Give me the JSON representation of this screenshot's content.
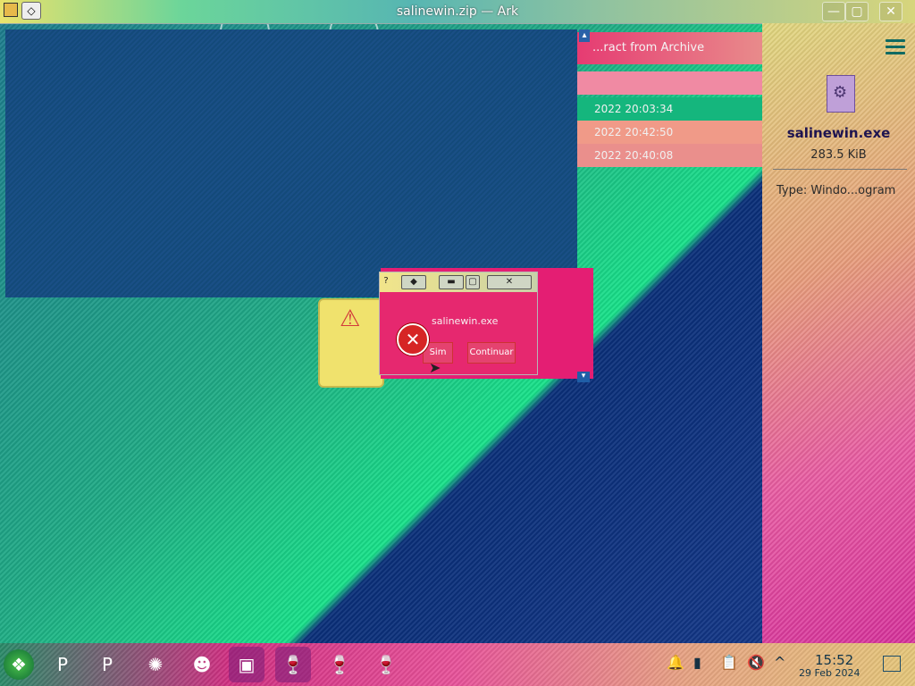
{
  "window": {
    "title": "salinewin.zip — Ark",
    "wm_menu_glyph": "◇",
    "minimize_glyph": "—",
    "maximize_glyph": "▢",
    "close_glyph": "✕"
  },
  "archive": {
    "header_label": "...ract from Archive",
    "rows": [
      {
        "modified": "2022 20:03:34"
      },
      {
        "modified": "2022 20:42:50"
      },
      {
        "modified": "2022 20:40:08"
      }
    ]
  },
  "details_panel": {
    "menu_icon": "hamburger-icon",
    "file_icon": "exe-file-icon",
    "file_name": "salinewin.exe",
    "file_size": "283.5 KiB",
    "type_text": "Type: Windo...ogram"
  },
  "dialogs": {
    "error_message": "salinewin.exe",
    "button_primary": "Sim",
    "button_secondary": "Continuar",
    "help_glyph": "?",
    "warning_glyph": "⚠",
    "error_glyph": "✕"
  },
  "taskbar": {
    "start_glyph": "❖",
    "items": [
      {
        "icon": "p-app-icon",
        "glyph": "P"
      },
      {
        "icon": "p-app-icon-2",
        "glyph": "P"
      },
      {
        "icon": "disc-icon",
        "glyph": "✺"
      },
      {
        "icon": "character-icon",
        "glyph": "☻"
      },
      {
        "icon": "box-icon",
        "glyph": "▣"
      },
      {
        "icon": "wine-icon",
        "glyph": "🍷"
      },
      {
        "icon": "wine-icon-2",
        "glyph": "🍷"
      },
      {
        "icon": "wine-icon-3",
        "glyph": "🍷"
      }
    ],
    "tray": {
      "notifications_glyph": "🔔",
      "clipboard_glyph": "📋",
      "volume_glyph": "🔇",
      "expand_glyph": "^"
    },
    "time": "15:52",
    "date": "29 Feb 2024"
  },
  "colors": {
    "accent": "#e41e73",
    "selection": "#15b67d",
    "panel_text": "#1e1450"
  }
}
